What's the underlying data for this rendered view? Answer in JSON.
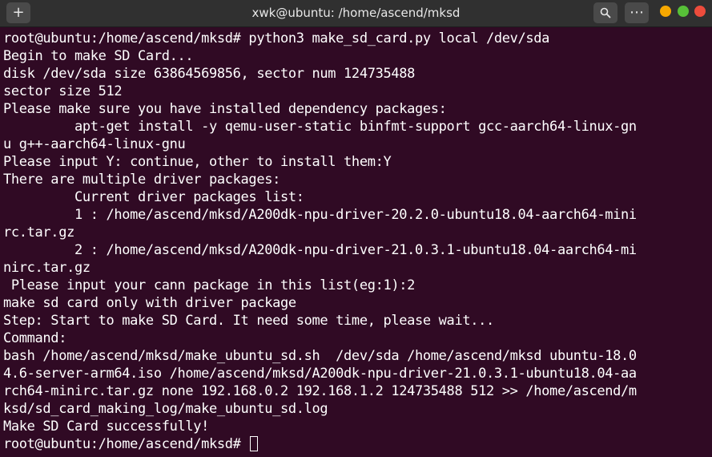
{
  "window": {
    "title": "xwk@ubuntu: /home/ascend/mksd",
    "new_tab_icon": "+",
    "search_icon": "⚲",
    "menu_icon": "⋯"
  },
  "terminal": {
    "lines": [
      "root@ubuntu:/home/ascend/mksd# python3 make_sd_card.py local /dev/sda",
      "Begin to make SD Card...",
      "disk /dev/sda size 63864569856, sector num 124735488",
      "sector size 512",
      "Please make sure you have installed dependency packages:",
      "         apt-get install -y qemu-user-static binfmt-support gcc-aarch64-linux-gn",
      "u g++-aarch64-linux-gnu",
      "Please input Y: continue, other to install them:Y",
      "There are multiple driver packages:",
      "         Current driver packages list:",
      "         1 : /home/ascend/mksd/A200dk-npu-driver-20.2.0-ubuntu18.04-aarch64-mini",
      "rc.tar.gz",
      "         2 : /home/ascend/mksd/A200dk-npu-driver-21.0.3.1-ubuntu18.04-aarch64-mi",
      "nirc.tar.gz",
      " Please input your cann package in this list(eg:1):2",
      "make sd card only with driver package",
      "Step: Start to make SD Card. It need some time, please wait...",
      "Command:",
      "bash /home/ascend/mksd/make_ubuntu_sd.sh  /dev/sda /home/ascend/mksd ubuntu-18.0",
      "4.6-server-arm64.iso /home/ascend/mksd/A200dk-npu-driver-21.0.3.1-ubuntu18.04-aa",
      "rch64-minirc.tar.gz none 192.168.0.2 192.168.1.2 124735488 512 >> /home/ascend/m",
      "ksd/sd_card_making_log/make_ubuntu_sd.log",
      "Make SD Card successfully!"
    ],
    "prompt": "root@ubuntu:/home/ascend/mksd# "
  },
  "colors": {
    "terminal_bg": "#300a24",
    "titlebar_bg": "#303030",
    "close": "#ed4c3c",
    "minimize": "#f6a700",
    "maximize": "#57c038"
  }
}
